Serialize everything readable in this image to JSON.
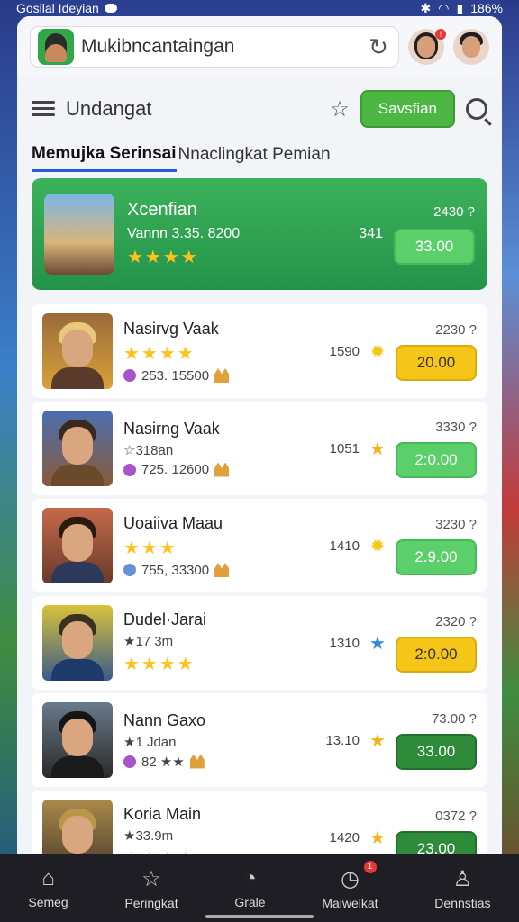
{
  "status": {
    "left_text": "Gosilal Ideyian",
    "right_text": "186%"
  },
  "appbar": {
    "url_text": "Mukibncantaingan",
    "notif_badge": "!"
  },
  "toolbar": {
    "title": "Undangat",
    "button_label": "Savsfian"
  },
  "tabs": [
    {
      "label": "Memujka Serinsai"
    },
    {
      "label": "Nnaclingkat Pemian"
    }
  ],
  "featured": {
    "name": "Xcenfian",
    "version": "Vannn 3.35. 8200",
    "stars": "★★★★",
    "count": "341",
    "score": "2430 ?",
    "price": "33.00"
  },
  "items": [
    {
      "name": "Nasirvg Vaak",
      "sub": "253. 15500",
      "stars": "★★★★",
      "mid": "1590",
      "score": "2230 ?",
      "price": "20.00"
    },
    {
      "name": "Nasirng Vaak",
      "sub": "725. 12600",
      "stars": "☆318an",
      "mid": "1051",
      "score": "3330 ?",
      "price": "2:0.00"
    },
    {
      "name": "Uoaiiva Maau",
      "sub": "755, 33300",
      "stars": "★★★",
      "mid": "1410",
      "score": "3230 ?",
      "price": "2.9.00"
    },
    {
      "name": "Dudel·Jarai",
      "sub": "★★★★",
      "stars": "★17 3m",
      "mid": "1310",
      "score": "2320 ?",
      "price": "2:0.00"
    },
    {
      "name": "Nann Gaxo",
      "sub": "82 ★★",
      "stars": "★1 Jdan",
      "mid": "13.10",
      "score": "73.00 ?",
      "price": "33.00"
    },
    {
      "name": "Koria Main",
      "sub": "★★★★",
      "stars": "★33.9m",
      "mid": "1420",
      "score": "0372 ?",
      "price": "23.00"
    }
  ],
  "nav": [
    {
      "label": "Semeg"
    },
    {
      "label": "Peringkat"
    },
    {
      "label": "Grale"
    },
    {
      "label": "Maiwelkat",
      "badge": "1"
    },
    {
      "label": "Dennstias"
    }
  ],
  "colors": {
    "accent_green": "#4cb843",
    "featured_green": "#2aa04e",
    "tab_underline": "#2a5bd7",
    "nav_bg": "#1e1e24"
  }
}
